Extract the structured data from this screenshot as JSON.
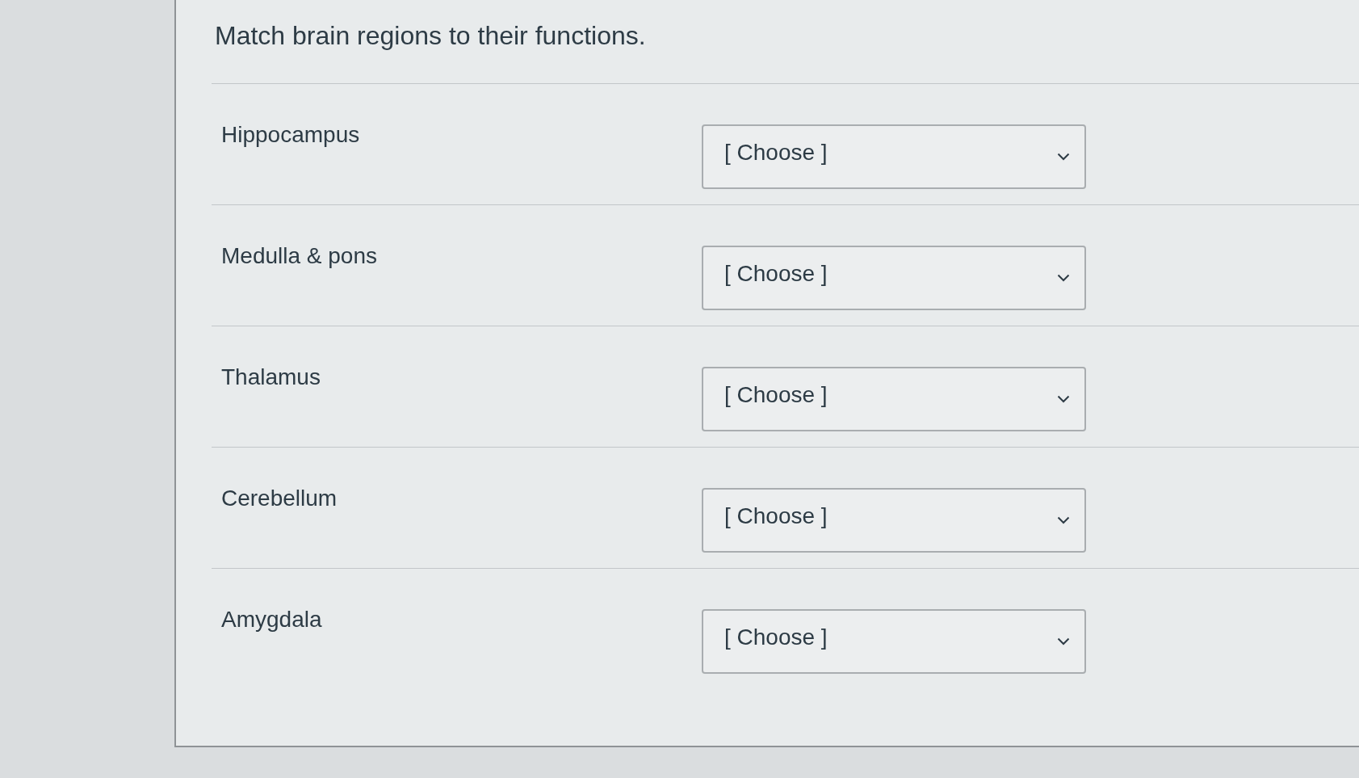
{
  "question": {
    "title": "Match brain regions to their functions."
  },
  "matches": [
    {
      "term": "Hippocampus",
      "answer": "[ Choose ]"
    },
    {
      "term": "Medulla & pons",
      "answer": "[ Choose ]"
    },
    {
      "term": "Thalamus",
      "answer": "[ Choose ]"
    },
    {
      "term": "Cerebellum",
      "answer": "[ Choose ]"
    },
    {
      "term": "Amygdala",
      "answer": "[ Choose ]"
    }
  ]
}
